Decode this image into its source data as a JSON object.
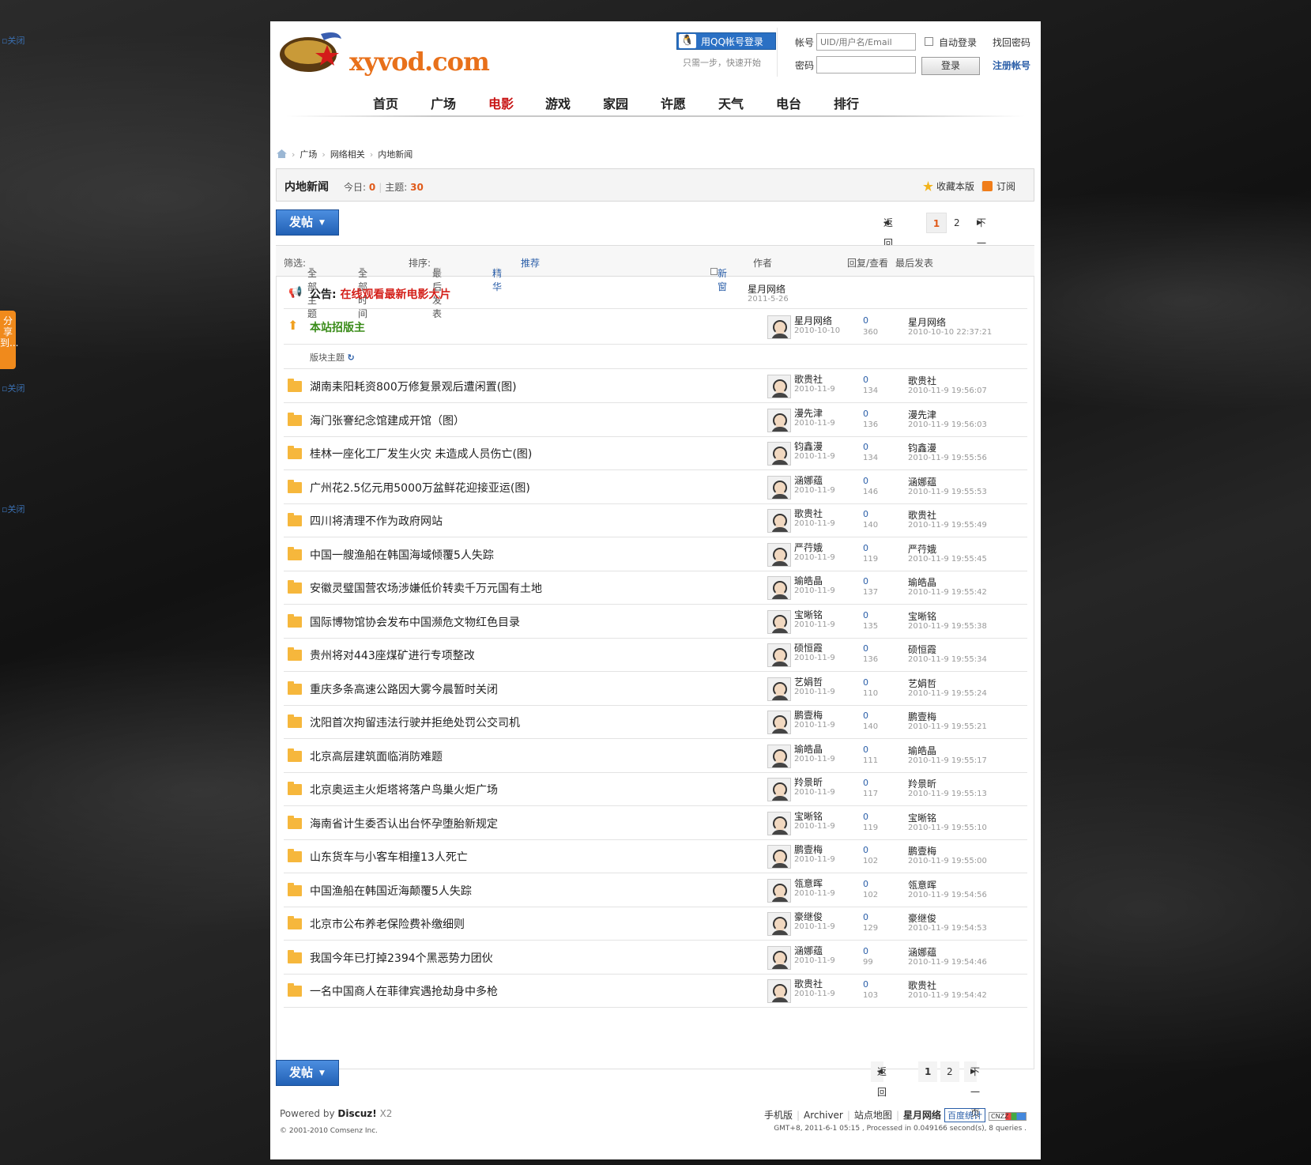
{
  "site": {
    "logo_text": "xyvod.com"
  },
  "side": {
    "close_label": "关闭",
    "share_label": "分享到..."
  },
  "login": {
    "qq_button": "用QQ帐号登录",
    "qq_sub": "只需一步，快速开始",
    "account_label": "帐号",
    "account_placeholder": "UID/用户名/Email",
    "auto_login": "自动登录",
    "find_password": "找回密码",
    "password_label": "密码",
    "login_button": "登录",
    "register": "注册帐号"
  },
  "nav": [
    "首页",
    "广场",
    "电影",
    "游戏",
    "家园",
    "许愿",
    "天气",
    "电台",
    "排行"
  ],
  "nav_active_index": 2,
  "breadcrumb": [
    "广场",
    "网络相关",
    "内地新闻"
  ],
  "forum": {
    "name": "内地新闻",
    "today_label": "今日:",
    "today_value": "0",
    "topics_label": "主题:",
    "topics_value": "30",
    "favorite": "收藏本版",
    "subscribe": "订阅"
  },
  "post_button": "发帖",
  "pager": {
    "back": "返 回",
    "pages": [
      "1",
      "2"
    ],
    "next": "下一页"
  },
  "filter": {
    "label": "筛选:",
    "all_topics": "全部主题",
    "all_time": "全部时间",
    "sort_label": "排序:",
    "sort_value": "最后发表",
    "digest": "精华",
    "recommend": "推荐",
    "new_window": "新窗",
    "col_author": "作者",
    "col_replies": "回复/查看",
    "col_last": "最后发表"
  },
  "announcement": {
    "prefix": "公告:",
    "title": "在线观看最新电影大片",
    "author": "星月网络",
    "date": "2011-5-26"
  },
  "sticky": {
    "title": "本站招版主",
    "author": "星月网络",
    "date": "2010-10-10",
    "replies": "0",
    "views": "360",
    "last_by": "星月网络",
    "last_time": "2010-10-10 22:37:21"
  },
  "section_label": "版块主题",
  "threads": [
    {
      "title": "湖南耒阳耗资800万修复景观后遭闲置(图)",
      "author": "歌贵社",
      "date": "2010-11-9",
      "replies": "0",
      "views": "134",
      "last_by": "歌贵社",
      "last_time": "2010-11-9 19:56:07"
    },
    {
      "title": "海门张謇纪念馆建成开馆（图）",
      "author": "漫先津",
      "date": "2010-11-9",
      "replies": "0",
      "views": "136",
      "last_by": "漫先津",
      "last_time": "2010-11-9 19:56:03"
    },
    {
      "title": "桂林一座化工厂发生火灾 未造成人员伤亡(图)",
      "author": "钧鑫漫",
      "date": "2010-11-9",
      "replies": "0",
      "views": "134",
      "last_by": "钧鑫漫",
      "last_time": "2010-11-9 19:55:56"
    },
    {
      "title": "广州花2.5亿元用5000万盆鲜花迎接亚运(图)",
      "author": "涵娜蕴",
      "date": "2010-11-9",
      "replies": "0",
      "views": "146",
      "last_by": "涵娜蕴",
      "last_time": "2010-11-9 19:55:53"
    },
    {
      "title": "四川将清理不作为政府网站",
      "author": "歌贵社",
      "date": "2010-11-9",
      "replies": "0",
      "views": "140",
      "last_by": "歌贵社",
      "last_time": "2010-11-9 19:55:49"
    },
    {
      "title": "中国一艘渔船在韩国海域倾覆5人失踪",
      "author": "严荇娥",
      "date": "2010-11-9",
      "replies": "0",
      "views": "119",
      "last_by": "严荇娥",
      "last_time": "2010-11-9 19:55:45"
    },
    {
      "title": "安徽灵璧国营农场涉嫌低价转卖千万元国有土地",
      "author": "瑜皓晶",
      "date": "2010-11-9",
      "replies": "0",
      "views": "137",
      "last_by": "瑜皓晶",
      "last_time": "2010-11-9 19:55:42"
    },
    {
      "title": "国际博物馆协会发布中国濒危文物红色目录",
      "author": "宝晰铭",
      "date": "2010-11-9",
      "replies": "0",
      "views": "135",
      "last_by": "宝晰铭",
      "last_time": "2010-11-9 19:55:38"
    },
    {
      "title": "贵州将对443座煤矿进行专项整改",
      "author": "硕恒霞",
      "date": "2010-11-9",
      "replies": "0",
      "views": "136",
      "last_by": "硕恒霞",
      "last_time": "2010-11-9 19:55:34"
    },
    {
      "title": "重庆多条高速公路因大雾今晨暂时关闭",
      "author": "艺娟哲",
      "date": "2010-11-9",
      "replies": "0",
      "views": "110",
      "last_by": "艺娟哲",
      "last_time": "2010-11-9 19:55:24"
    },
    {
      "title": "沈阳首次拘留违法行驶并拒绝处罚公交司机",
      "author": "鹏壹梅",
      "date": "2010-11-9",
      "replies": "0",
      "views": "140",
      "last_by": "鹏壹梅",
      "last_time": "2010-11-9 19:55:21"
    },
    {
      "title": "北京高层建筑面临消防难题",
      "author": "瑜皓晶",
      "date": "2010-11-9",
      "replies": "0",
      "views": "111",
      "last_by": "瑜皓晶",
      "last_time": "2010-11-9 19:55:17"
    },
    {
      "title": "北京奥运主火炬塔将落户鸟巢火炬广场",
      "author": "羚景昕",
      "date": "2010-11-9",
      "replies": "0",
      "views": "117",
      "last_by": "羚景昕",
      "last_time": "2010-11-9 19:55:13"
    },
    {
      "title": "海南省计生委否认出台怀孕堕胎新规定",
      "author": "宝晰铭",
      "date": "2010-11-9",
      "replies": "0",
      "views": "119",
      "last_by": "宝晰铭",
      "last_time": "2010-11-9 19:55:10"
    },
    {
      "title": "山东货车与小客车相撞13人死亡",
      "author": "鹏壹梅",
      "date": "2010-11-9",
      "replies": "0",
      "views": "102",
      "last_by": "鹏壹梅",
      "last_time": "2010-11-9 19:55:00"
    },
    {
      "title": "中国渔船在韩国近海颠覆5人失踪",
      "author": "瓴意晖",
      "date": "2010-11-9",
      "replies": "0",
      "views": "102",
      "last_by": "瓴意晖",
      "last_time": "2010-11-9 19:54:56"
    },
    {
      "title": "北京市公布养老保险费补缴细则",
      "author": "豪继俊",
      "date": "2010-11-9",
      "replies": "0",
      "views": "129",
      "last_by": "豪继俊",
      "last_time": "2010-11-9 19:54:53"
    },
    {
      "title": "我国今年已打掉2394个黑恶势力团伙",
      "author": "涵娜蕴",
      "date": "2010-11-9",
      "replies": "0",
      "views": "99",
      "last_by": "涵娜蕴",
      "last_time": "2010-11-9 19:54:46"
    },
    {
      "title": "一名中国商人在菲律宾遇抢劫身中多枪",
      "author": "歌贵社",
      "date": "2010-11-9",
      "replies": "0",
      "views": "103",
      "last_by": "歌贵社",
      "last_time": "2010-11-9 19:54:42"
    }
  ],
  "footer": {
    "powered": "Powered by",
    "brand": "Discuz!",
    "version": "X2",
    "copyright": "© 2001-2010 Comsenz Inc.",
    "links": [
      "手机版",
      "Archiver",
      "站点地图",
      "星月网络"
    ],
    "baidu": "百度统计",
    "cnzz": "CNZZ",
    "processed": "GMT+8, 2011-6-1 05:15 , Processed in 0.049166 second(s), 8 queries ."
  }
}
